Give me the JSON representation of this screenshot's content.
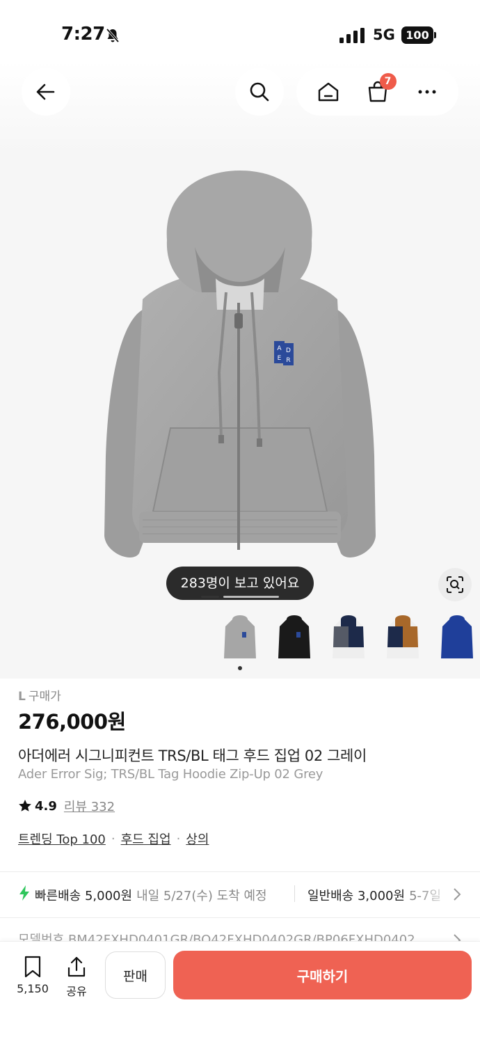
{
  "status": {
    "time": "7:27",
    "network": "5G",
    "battery": "100"
  },
  "nav": {
    "cart_count": "7"
  },
  "hero": {
    "viewer_text": "283명이 보고 있어요",
    "patch_letters": [
      "A",
      "E",
      "D",
      "R"
    ],
    "variants": [
      "grey",
      "black",
      "navy-grey-white",
      "navy-brown-white",
      "blue"
    ]
  },
  "product": {
    "size": "L",
    "price_label": "구매가",
    "price": "276,000원",
    "name_ko": "아더에러 시그니피컨트 TRS/BL 태그 후드 집업 02 그레이",
    "name_en": "Ader Error Sig; TRS/BL Tag Hoodie Zip-Up 02 Grey",
    "rating": "4.9",
    "review_label": "리뷰 332",
    "tags": [
      "트렌딩 Top 100",
      "후드 집업",
      "상의"
    ]
  },
  "delivery": {
    "fast_label": "빠른배송 5,000원",
    "fast_eta": "내일 5/27(수) 도착 예정",
    "normal_label": "일반배송 3,000원",
    "normal_eta": "5-7일"
  },
  "model": {
    "text": "모델번호 BM42FXHD0401GR/BO42FXHD0402GR/BP06FXHD0402"
  },
  "bottom": {
    "save_count": "5,150",
    "share_label": "공유",
    "sell_label": "판매",
    "buy_label": "구매하기"
  },
  "colors": {
    "accent": "#ef6253",
    "badge": "#ef5b4a",
    "hoodie": "#a3a3a3",
    "patch": "#2b4a9a"
  },
  "icons": [
    "back-arrow-icon",
    "search-icon",
    "home-icon",
    "shopping-bag-icon",
    "more-icon",
    "lens-icon",
    "star-icon",
    "bolt-icon",
    "chevron-right-icon",
    "bookmark-icon",
    "share-icon",
    "bell-slash-icon",
    "signal-icon"
  ]
}
